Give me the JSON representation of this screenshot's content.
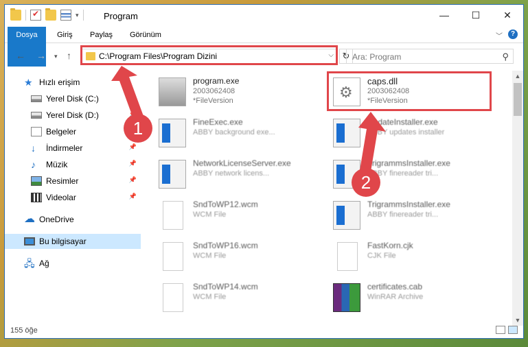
{
  "window": {
    "title": "Program",
    "controls": {
      "minimize": "—",
      "maximize": "☐",
      "close": "✕"
    }
  },
  "ribbon": {
    "tabs": [
      {
        "label": "Dosya"
      },
      {
        "label": "Giriş"
      },
      {
        "label": "Paylaş"
      },
      {
        "label": "Görünüm"
      }
    ],
    "help": "?"
  },
  "navigation": {
    "address_path": "C:\\Program Files\\Program Dizini",
    "search_placeholder": "Ara: Program"
  },
  "sidebar": {
    "items": [
      {
        "label": "Hızlı erişim",
        "icon": "star-icon"
      },
      {
        "label": "Yerel Disk (C:)",
        "icon": "disk-icon",
        "pinned": true
      },
      {
        "label": "Yerel Disk (D:)",
        "icon": "disk-icon",
        "pinned": true
      },
      {
        "label": "Belgeler",
        "icon": "documents-icon",
        "pinned": true
      },
      {
        "label": "İndirmeler",
        "icon": "download-icon",
        "pinned": true
      },
      {
        "label": "Müzik",
        "icon": "music-icon",
        "pinned": true
      },
      {
        "label": "Resimler",
        "icon": "pictures-icon",
        "pinned": true
      },
      {
        "label": "Videolar",
        "icon": "videos-icon",
        "pinned": true
      },
      {
        "label": "OneDrive",
        "icon": "cloud-icon"
      },
      {
        "label": "Bu bilgisayar",
        "icon": "computer-icon",
        "selected": true
      },
      {
        "label": "Ağ",
        "icon": "network-icon"
      }
    ]
  },
  "files": [
    {
      "name": "program.exe",
      "line1": "2003062408",
      "line2": "*FileVersion",
      "icon": "program-icon"
    },
    {
      "name": "caps.dll",
      "line1": "2003062408",
      "line2": "*FileVersion",
      "icon": "dll-gear-icon",
      "highlighted": true
    },
    {
      "name": "FineExec.exe",
      "line1": "ABBY background exe...",
      "line2": "",
      "icon": "exe-icon"
    },
    {
      "name": "UpdateInstaller.exe",
      "line1": "ABBY updates installer",
      "line2": "",
      "icon": "exe-icon"
    },
    {
      "name": "NetworkLicenseServer.exe",
      "line1": "ABBY network licens...",
      "line2": "",
      "icon": "exe-icon"
    },
    {
      "name": "TrigrammsInstaller.exe",
      "line1": "ABBY finereader tri...",
      "line2": "",
      "icon": "exe-icon"
    },
    {
      "name": "SndToWP12.wcm",
      "line1": "WCM File",
      "line2": "",
      "icon": "file-icon"
    },
    {
      "name": "TrigrammsInstaller.exe",
      "line1": "ABBY finereader tri...",
      "line2": "",
      "icon": "exe-icon"
    },
    {
      "name": "SndToWP16.wcm",
      "line1": "WCM File",
      "line2": "",
      "icon": "file-icon"
    },
    {
      "name": "FastKorn.cjk",
      "line1": "CJK File",
      "line2": "",
      "icon": "file-icon"
    },
    {
      "name": "SndToWP14.wcm",
      "line1": "WCM File",
      "line2": "",
      "icon": "file-icon"
    },
    {
      "name": "certificates.cab",
      "line1": "WinRAR Archive",
      "line2": "",
      "icon": "archive-icon"
    }
  ],
  "status": {
    "item_count": "155 öğe"
  },
  "annotations": [
    {
      "label": "1"
    },
    {
      "label": "2"
    }
  ],
  "colors": {
    "accent": "#1979ca",
    "highlight": "#e0464a",
    "selection": "#cce8ff"
  }
}
